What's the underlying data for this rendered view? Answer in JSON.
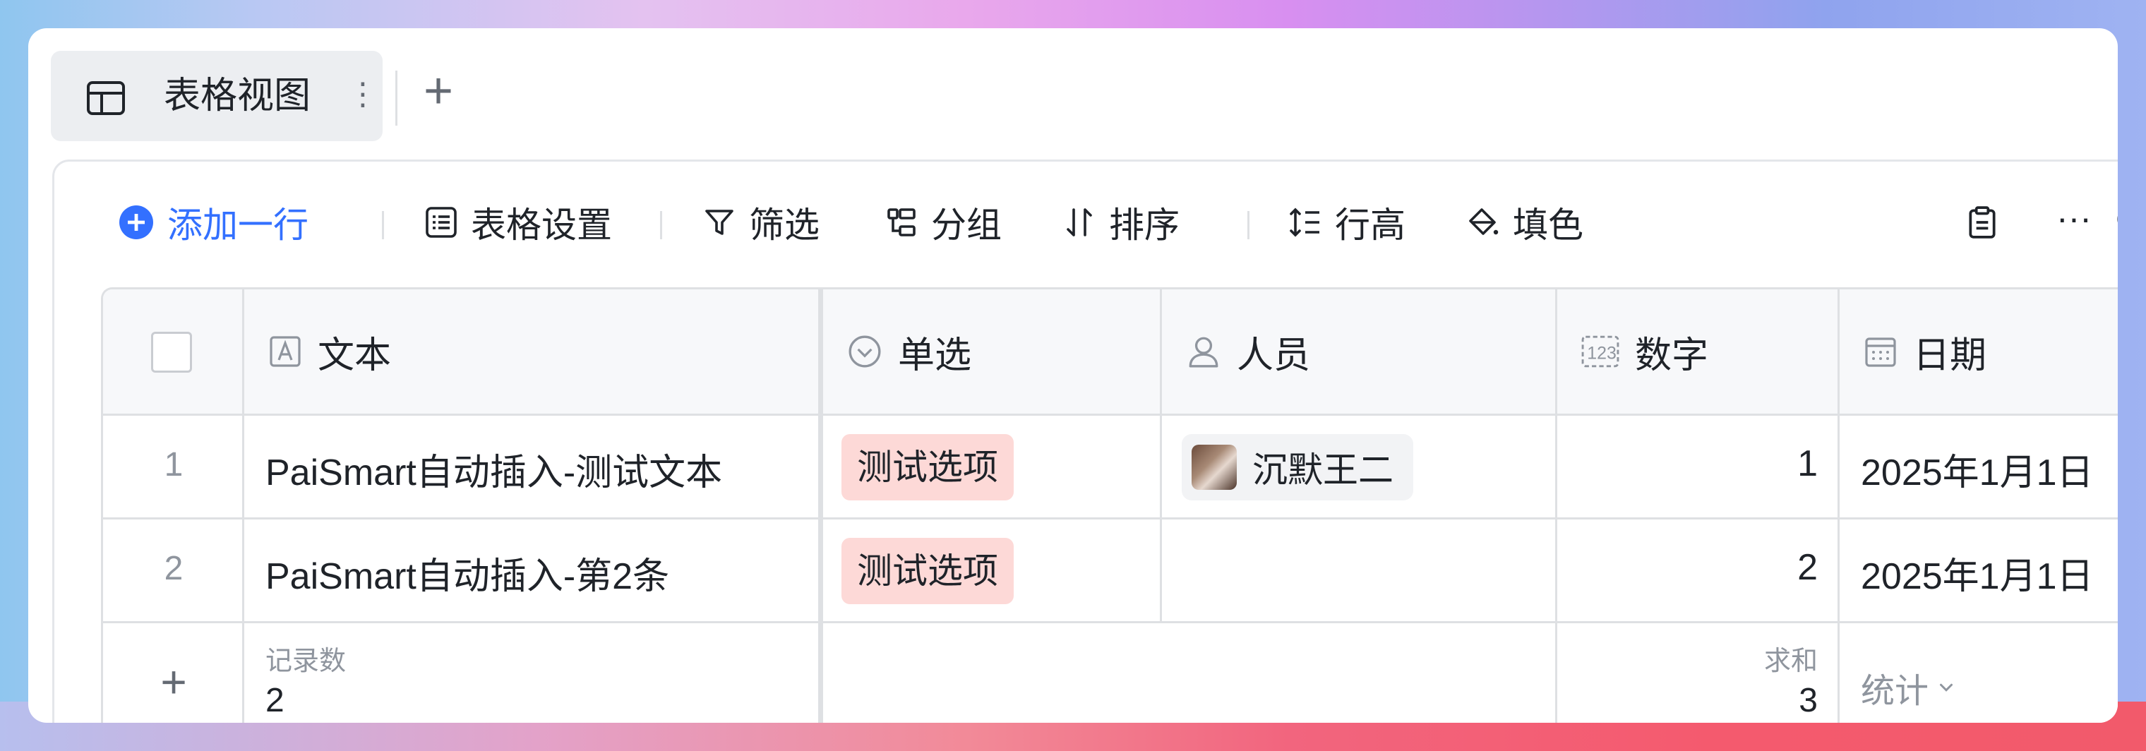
{
  "tabs": {
    "active_label": "表格视图",
    "more_label": "⋮",
    "add_label": "+"
  },
  "toolbar": {
    "add_row_label": "添加一行",
    "table_settings_label": "表格设置",
    "filter_label": "筛选",
    "group_label": "分组",
    "sort_label": "排序",
    "row_height_label": "行高",
    "fill_color_label": "填色",
    "more_label": "···"
  },
  "columns": {
    "text": "文本",
    "single_select": "单选",
    "person": "人员",
    "number": "数字",
    "date": "日期"
  },
  "rows": [
    {
      "index": "1",
      "text": "PaiSmart自动插入-测试文本",
      "select": "测试选项",
      "person": "沉默王二",
      "number": "1",
      "date": "2025年1月1日"
    },
    {
      "index": "2",
      "text": "PaiSmart自动插入-第2条",
      "select": "测试选项",
      "person": "",
      "number": "2",
      "date": "2025年1月1日"
    }
  ],
  "footer": {
    "add_label": "+",
    "record_count_label": "记录数",
    "record_count_value": "2",
    "sum_label": "求和",
    "sum_value": "3",
    "stat_label": "统计"
  },
  "colors": {
    "accent": "#3370ff",
    "tag_bg": "#fdd9d7",
    "border": "#dee0e3"
  }
}
